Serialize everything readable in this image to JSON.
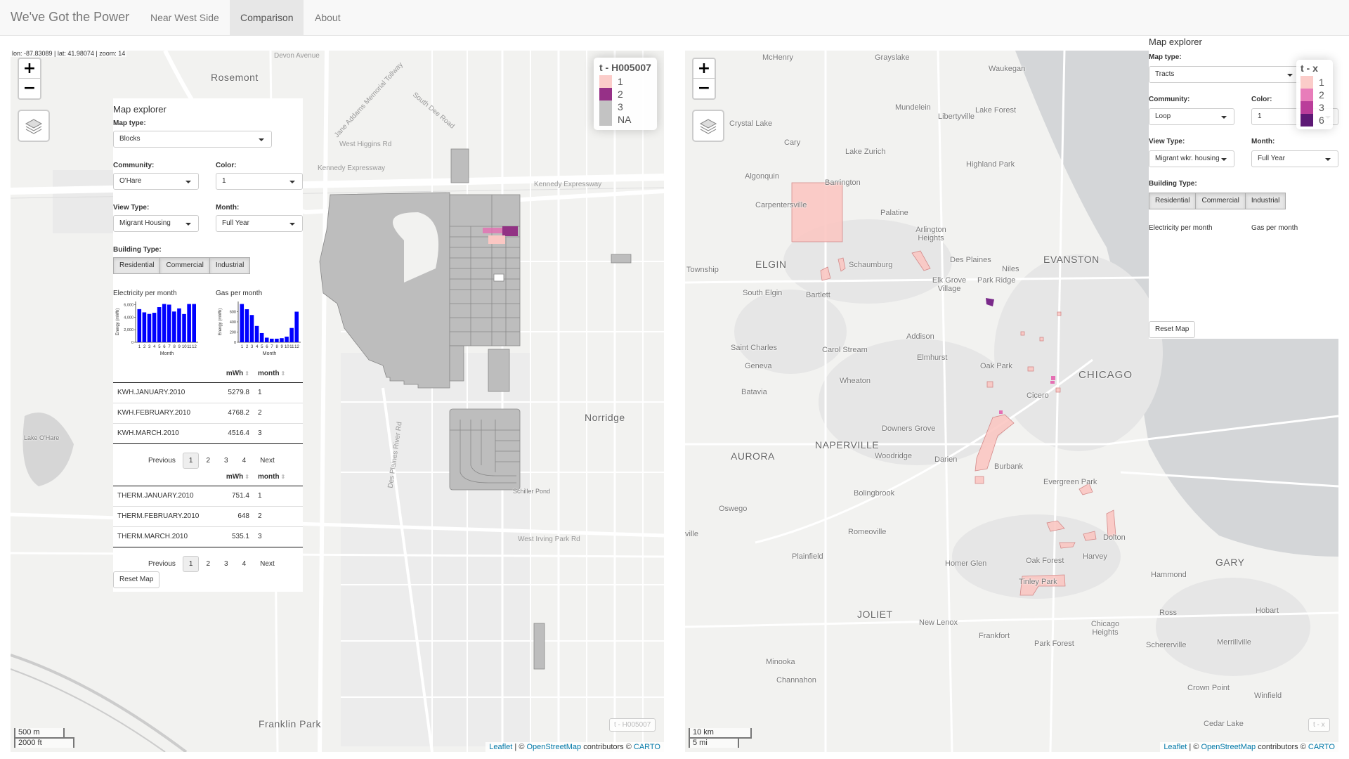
{
  "navbar": {
    "brand": "We've Got the Power",
    "tabs": [
      {
        "label": "Near West Side",
        "active": false
      },
      {
        "label": "Comparison",
        "active": true
      },
      {
        "label": "About",
        "active": false
      }
    ]
  },
  "left_map": {
    "coord_readout": "lon: -87.83089 | lat: 41.98074 | zoom: 14",
    "zoom_in": "+",
    "zoom_out": "−",
    "legend": {
      "title": "t - H005007",
      "items": [
        {
          "label": "1",
          "color": "#fbc7c3"
        },
        {
          "label": "2",
          "color": "#8b1a7a"
        },
        {
          "label": "3",
          "color": "#bdbdbd"
        },
        {
          "label": "NA",
          "color": "#bdbdbd"
        }
      ]
    },
    "watermark": "t - H005007",
    "scale_top": "500 m",
    "scale_bottom": "2000 ft",
    "places": {
      "rosemont": "Rosemont",
      "norridge": "Norridge",
      "franklin_park": "Franklin Park",
      "lake_ohare": "Lake O'Hare",
      "schiller_pond": "Schiller Pond"
    },
    "roads": {
      "south_dee": "South Dee Road",
      "w_higgins": "West Higgins Rd",
      "kennedy_expy": "Kennedy Expressway",
      "kennedy_expy2": "Kennedy Expressway",
      "irving_park": "West Irving Park Rd",
      "des_plaines": "Des Plaines River Rd",
      "addams": "Jane Addams Memorial Tollway",
      "devon": "Devon Avenue"
    },
    "explorer": {
      "title": "Map explorer",
      "map_type_label": "Map type:",
      "map_type_value": "Blocks",
      "community_label": "Community:",
      "community_value": "O'Hare",
      "color_label": "Color:",
      "color_value": "1",
      "view_type_label": "View Type:",
      "view_type_value": "Migrant Housing",
      "month_label": "Month:",
      "month_value": "Full Year",
      "building_type_label": "Building Type:",
      "building_types": [
        "Residential",
        "Commercial",
        "Industrial"
      ],
      "elec_title": "Electricity per month",
      "gas_title": "Gas per month",
      "elec_chart": {
        "ylabel": "Energy (mWh)",
        "xlabel": "Month",
        "yticks": [
          "6,000",
          "4,000",
          "2,000",
          "0"
        ],
        "xticks": [
          "1",
          "2",
          "3",
          "4",
          "5",
          "6",
          "7",
          "8",
          "9",
          "10",
          "11",
          "12"
        ],
        "values": [
          5280,
          4768,
          4516,
          4700,
          5600,
          6100,
          6000,
          4900,
          5400,
          4500,
          6100,
          6100
        ],
        "ymax": 6500
      },
      "gas_chart": {
        "ylabel": "Energy (mWh)",
        "xlabel": "Month",
        "yticks": [
          "600",
          "400",
          "200",
          "0"
        ],
        "xticks": [
          "1",
          "2",
          "3",
          "4",
          "5",
          "6",
          "7",
          "8",
          "9",
          "10",
          "11",
          "12"
        ],
        "values": [
          751,
          648,
          535,
          320,
          180,
          90,
          70,
          70,
          80,
          110,
          280,
          600
        ],
        "ymax": 800
      },
      "elec_table": {
        "headers": [
          "",
          "mWh",
          "month"
        ],
        "rows": [
          [
            "KWH.JANUARY.2010",
            "5279.8",
            "1"
          ],
          [
            "KWH.FEBRUARY.2010",
            "4768.2",
            "2"
          ],
          [
            "KWH.MARCH.2010",
            "4516.4",
            "3"
          ]
        ],
        "pager": {
          "prev": "Previous",
          "pages": [
            "1",
            "2",
            "3",
            "4"
          ],
          "next": "Next"
        }
      },
      "gas_table": {
        "headers": [
          "",
          "mWh",
          "month"
        ],
        "rows": [
          [
            "THERM.JANUARY.2010",
            "751.4",
            "1"
          ],
          [
            "THERM.FEBRUARY.2010",
            "648",
            "2"
          ],
          [
            "THERM.MARCH.2010",
            "535.1",
            "3"
          ]
        ],
        "pager": {
          "prev": "Previous",
          "pages": [
            "1",
            "2",
            "3",
            "4"
          ],
          "next": "Next"
        }
      },
      "reset": "Reset Map"
    }
  },
  "right_map": {
    "zoom_in": "+",
    "zoom_out": "−",
    "legend": {
      "title": "t - x",
      "items": [
        {
          "label": "1",
          "color": "#fbc7c3"
        },
        {
          "label": "2",
          "color": "#e56fb3"
        },
        {
          "label": "3",
          "color": "#b3288f"
        },
        {
          "label": "6",
          "color": "#4b0066"
        }
      ]
    },
    "watermark": "t - x",
    "scale_top": "10 km",
    "scale_bottom": "5 mi",
    "places": {
      "mchenry": "McHenry",
      "grayslake": "Grayslake",
      "waukegan": "Waukegan",
      "crystal_lake": "Crystal Lake",
      "mundelein": "Mundelein",
      "libertyville": "Libertyville",
      "lake_forest": "Lake Forest",
      "cary": "Cary",
      "lake_zurich": "Lake Zurich",
      "highland_park": "Highland Park",
      "algonquin": "Algonquin",
      "barrington": "Barrington",
      "carpentersville": "Carpentersville",
      "palatine": "Palatine",
      "arlington": "Arlington Heights",
      "elgin": "ELGIN",
      "schaumburg": "Schaumburg",
      "des_plaines": "Des Plaines",
      "evanston": "EVANSTON",
      "niles": "Niles",
      "township": "Township",
      "south_elgin": "South Elgin",
      "bartlett": "Bartlett",
      "elk_grove": "Elk Grove Village",
      "park_ridge": "Park Ridge",
      "addison": "Addison",
      "saint_charles": "Saint Charles",
      "carol_stream": "Carol Stream",
      "elmhurst": "Elmhurst",
      "geneva": "Geneva",
      "oak_park": "Oak Park",
      "chicago": "CHICAGO",
      "wheaton": "Wheaton",
      "batavia": "Batavia",
      "cicero": "Cicero",
      "downers_grove": "Downers Grove",
      "aurora": "AURORA",
      "naperville": "NAPERVILLE",
      "woodridge": "Woodridge",
      "darien": "Darien",
      "burbank": "Burbank",
      "evergreen_park": "Evergreen Park",
      "oswego": "Oswego",
      "bolingbrook": "Bolingbrook",
      "romeoville": "Romeoville",
      "plainfield": "Plainfield",
      "homer_glen": "Homer Glen",
      "harvey": "Harvey",
      "dolton": "Dolton",
      "oak_forest": "Oak Forest",
      "hammond": "Hammond",
      "gary": "GARY",
      "tinley_park": "Tinley Park",
      "joliet": "JOLIET",
      "new_lenox": "New Lenox",
      "chicago_heights": "Chicago Heights",
      "frankfort": "Frankfort",
      "park_forest": "Park Forest",
      "ross": "Ross",
      "hobart": "Hobart",
      "schererville": "Schererville",
      "merrillville": "Merrillville",
      "minooka": "Minooka",
      "channahon": "Channahon",
      "crown_point": "Crown Point",
      "winfield": "Winfield",
      "cedar_lake": "Cedar Lake",
      "ville": "ville"
    },
    "explorer": {
      "title": "Map explorer",
      "map_type_label": "Map type:",
      "map_type_value": "Tracts",
      "community_label": "Community:",
      "community_value": "Loop",
      "color_label": "Color:",
      "color_value": "1",
      "view_type_label": "View Type:",
      "view_type_value": "Migrant wkr. housing",
      "month_label": "Month:",
      "month_value": "Full Year",
      "building_type_label": "Building Type:",
      "building_types": [
        "Residential",
        "Commercial",
        "Industrial"
      ],
      "elec_title": "Electricity per month",
      "gas_title": "Gas per month",
      "reset": "Reset Map"
    }
  },
  "attribution": {
    "leaflet": "Leaflet",
    "sep": " | © ",
    "osm": "OpenStreetMap",
    "contrib": " contributors © ",
    "carto": "CARTO"
  }
}
